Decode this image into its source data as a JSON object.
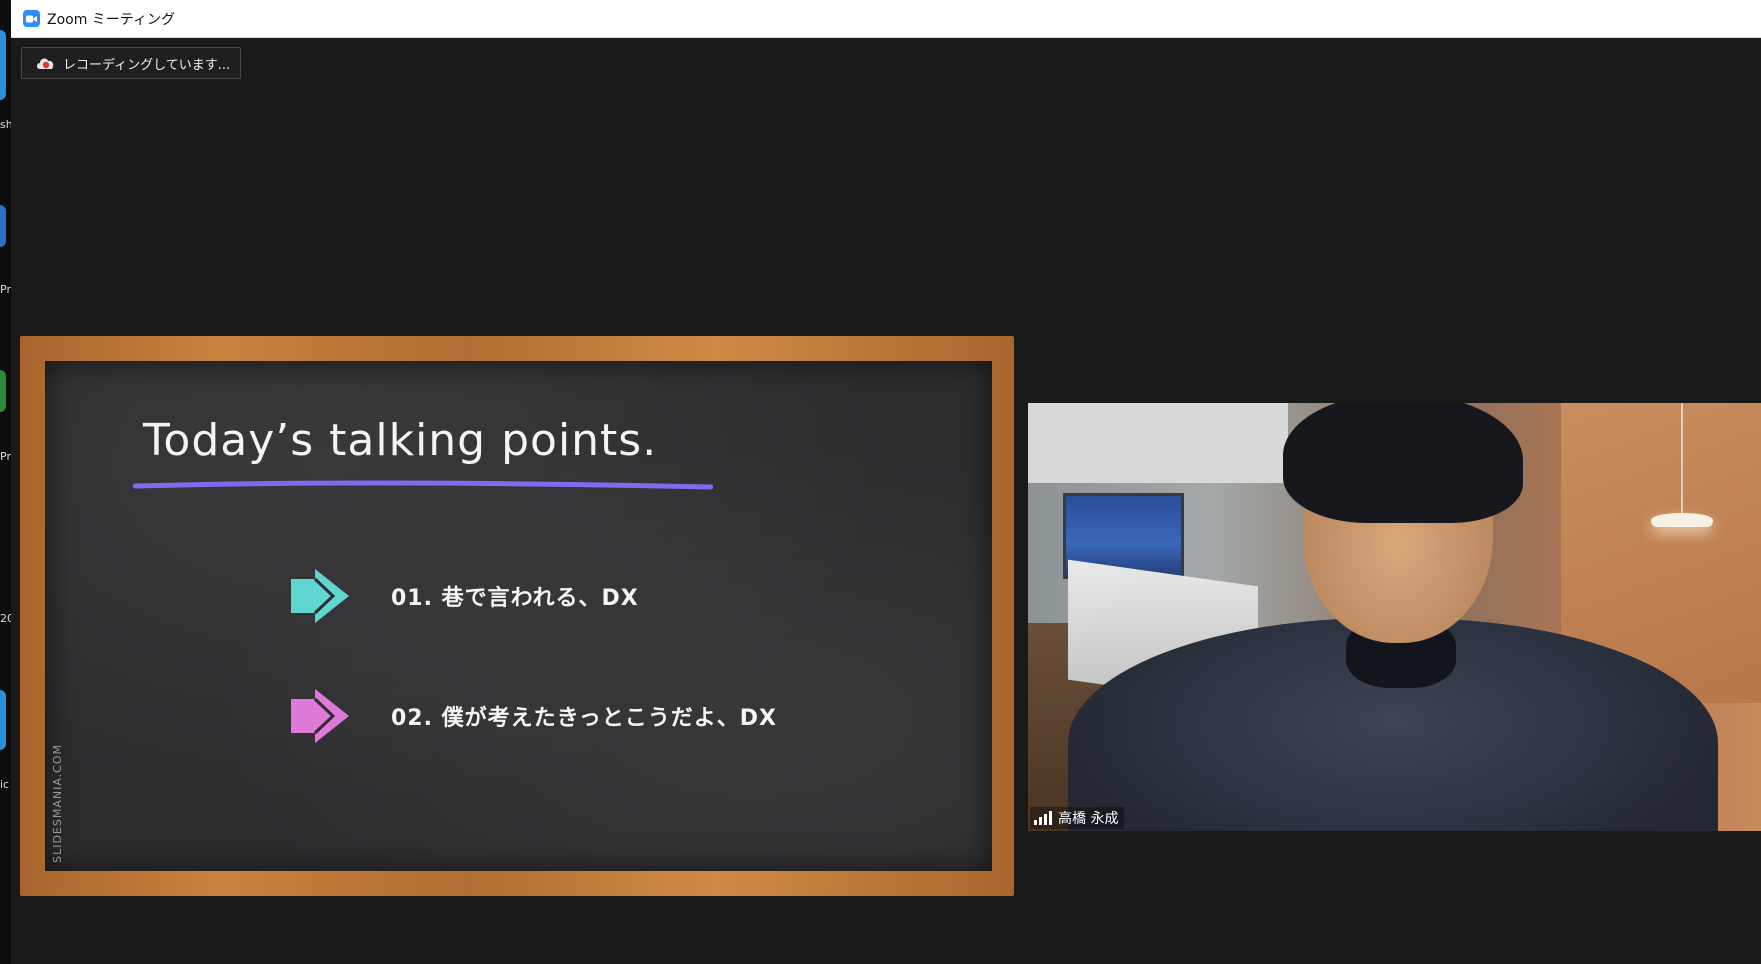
{
  "window": {
    "title": "Zoom ミーティング",
    "app_icon": "zoom-camera-icon"
  },
  "recording": {
    "label": "レコーディングしています..."
  },
  "desktop_strip": {
    "fragments": [
      "sh",
      "Pro",
      "Pro",
      "20",
      "ic"
    ]
  },
  "shared_slide": {
    "title": "Today’s talking points.",
    "points": [
      {
        "text": "01.  巷で言われる、DX",
        "color": "#5fd6d0"
      },
      {
        "text": "02.  僕が考えたきっとこうだよ、DX",
        "color": "#e07ad8"
      }
    ],
    "watermark": "SLIDESMANIA.COM",
    "underline_color": "#7d6cf0"
  },
  "video_tile": {
    "participant_name": "高橋 永成",
    "signal_icon": "signal-strength-icon"
  }
}
